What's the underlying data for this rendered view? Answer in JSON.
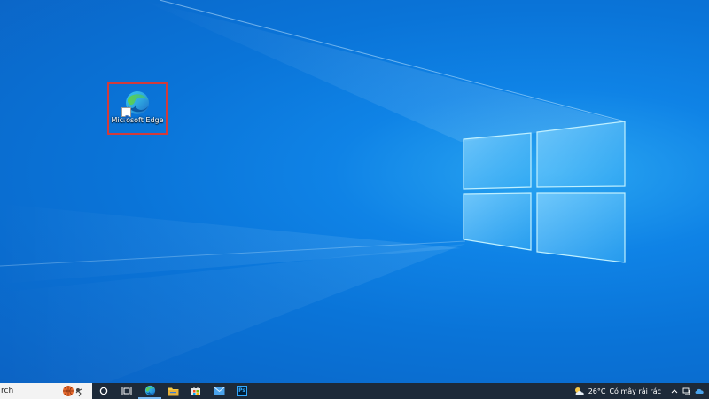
{
  "desktop": {
    "shortcut": {
      "label": "Microsoft Edge",
      "highlight_color": "#d23b3b"
    }
  },
  "taskbar": {
    "search_placeholder": "rch",
    "apps": [
      "cortana-icon",
      "task-view-icon",
      "edge-icon",
      "file-explorer-icon",
      "store-icon",
      "mail-icon",
      "photoshop-icon"
    ],
    "photoshop_label": "Ps",
    "weather": {
      "temperature": "26°C",
      "description": "Có mây rải rác"
    }
  },
  "colors": {
    "taskbar": "#1d2a39",
    "wallpaper_blue": "#0a74d8",
    "window_light": "#7fd0ff"
  }
}
